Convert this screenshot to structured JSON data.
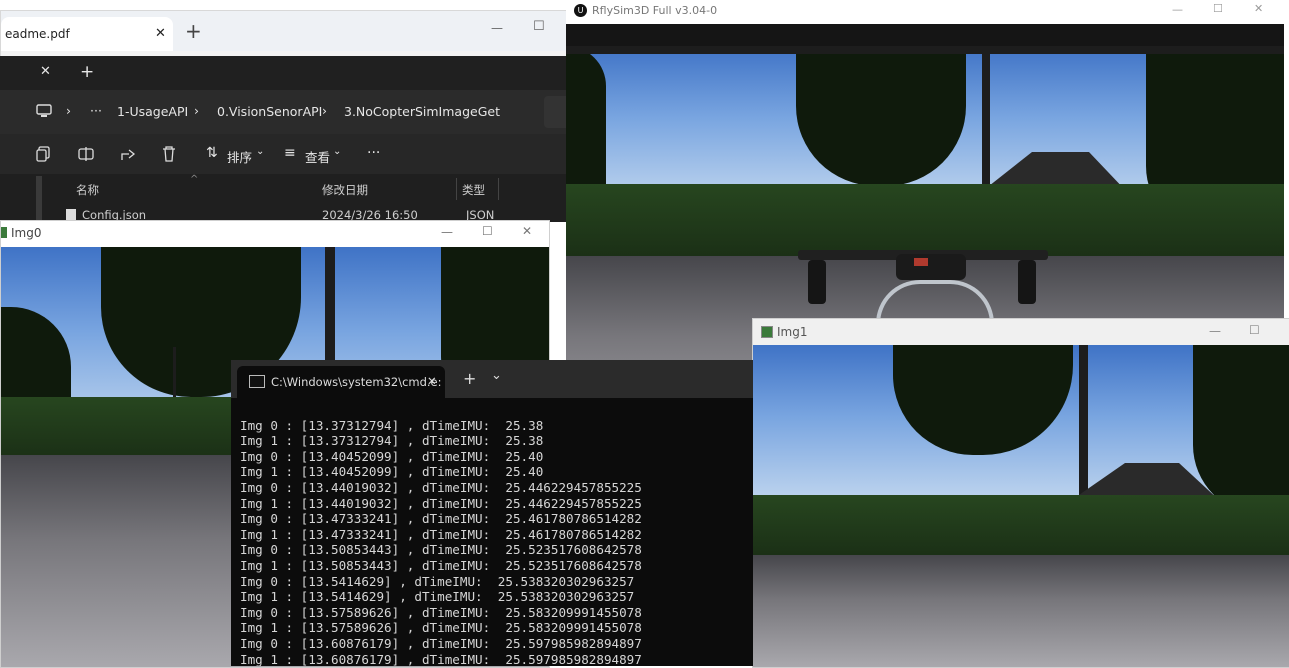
{
  "pdf": {
    "tab_title": "eadme.pdf",
    "close": "✕",
    "new_tab": "+",
    "min": "—",
    "max": "☐"
  },
  "explorer": {
    "tab_close": "✕",
    "tab_new": "+",
    "breadcrumb": [
      "1-UsageAPI",
      "0.VisionSenorAPI",
      "3.NoCopterSimImageGet"
    ],
    "more": "···",
    "sort_label": "排序",
    "view_label": "查看",
    "overflow": "···",
    "col_name": "名称",
    "col_date": "修改日期",
    "col_type": "类型",
    "file_name": "Config.json",
    "file_date": "2024/3/26 16:50",
    "file_type": "JSON"
  },
  "img0": {
    "title": "Img0",
    "min": "—",
    "max": "☐",
    "close": "✕"
  },
  "rfly": {
    "title": "RflySim3D Full v3.04-0",
    "min": "—",
    "max": "☐",
    "close": "✕"
  },
  "img1": {
    "title": "Img1",
    "min": "—",
    "max": "☐"
  },
  "cmd": {
    "tab_title": "C:\\Windows\\system32\\cmd.e:",
    "close": "✕",
    "new": "+",
    "dropdown": "⌄",
    "lines": [
      "Img 0 : [13.37312794] , dTimeIMU:  25.38",
      "Img 1 : [13.37312794] , dTimeIMU:  25.38",
      "Img 0 : [13.40452099] , dTimeIMU:  25.40",
      "Img 1 : [13.40452099] , dTimeIMU:  25.40",
      "Img 0 : [13.44019032] , dTimeIMU:  25.446229457855225",
      "Img 1 : [13.44019032] , dTimeIMU:  25.446229457855225",
      "Img 0 : [13.47333241] , dTimeIMU:  25.461780786514282",
      "Img 1 : [13.47333241] , dTimeIMU:  25.461780786514282",
      "Img 0 : [13.50853443] , dTimeIMU:  25.523517608642578",
      "Img 1 : [13.50853443] , dTimeIMU:  25.523517608642578",
      "Img 0 : [13.5414629] , dTimeIMU:  25.538320302963257",
      "Img 1 : [13.5414629] , dTimeIMU:  25.538320302963257",
      "Img 0 : [13.57589626] , dTimeIMU:  25.583209991455078",
      "Img 1 : [13.57589626] , dTimeIMU:  25.583209991455078",
      "Img 0 : [13.60876179] , dTimeIMU:  25.597985982894897",
      "Img 1 : [13.60876179] , dTimeIMU:  25.597985982894897"
    ]
  }
}
